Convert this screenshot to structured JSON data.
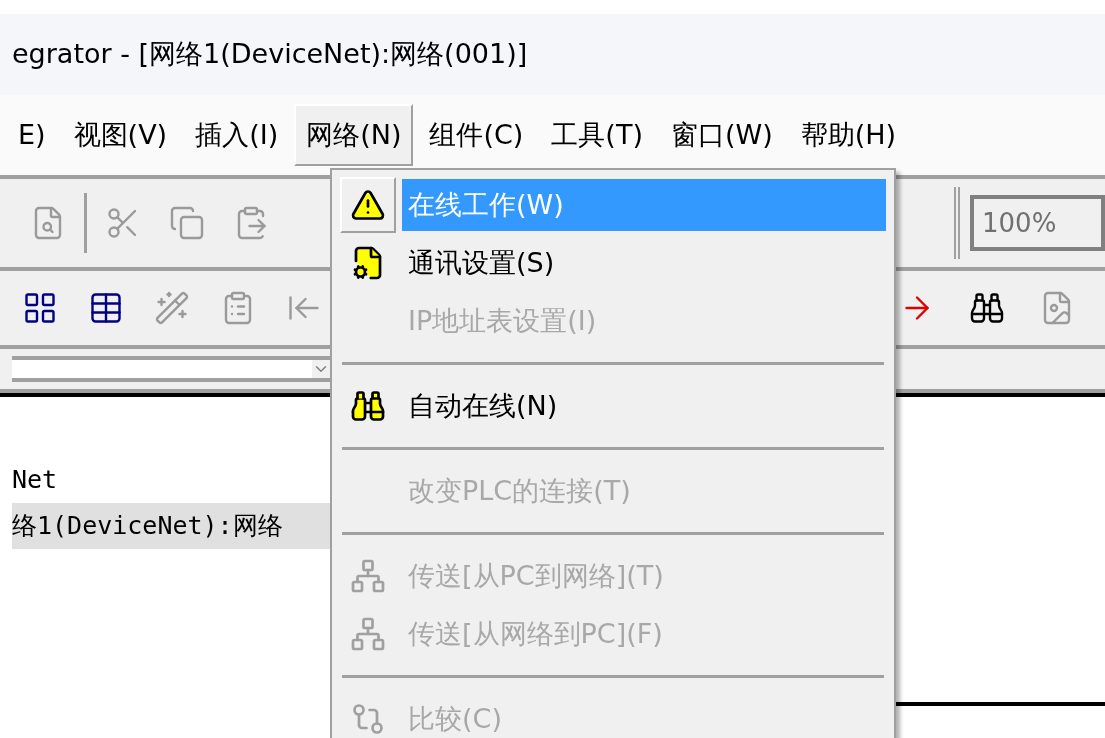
{
  "window": {
    "title": "egrator - [网络1(DeviceNet):网络(001)]"
  },
  "menu_bar": [
    {
      "label": "E)",
      "selected": false
    },
    {
      "label": "视图(V)",
      "selected": false
    },
    {
      "label": "插入(I)",
      "selected": false
    },
    {
      "label": "网络(N)",
      "selected": true
    },
    {
      "label": "组件(C)",
      "selected": false
    },
    {
      "label": "工具(T)",
      "selected": false
    },
    {
      "label": "窗口(W)",
      "selected": false
    },
    {
      "label": "帮助(H)",
      "selected": false
    }
  ],
  "zoom_field": {
    "value": "100%"
  },
  "tree": [
    {
      "label": "Net",
      "selected": false
    },
    {
      "label": "络1(DeviceNet):网络",
      "selected": true
    }
  ],
  "network_menu": [
    {
      "kind": "item",
      "label": "在线工作(W)",
      "selected": true,
      "disabled": false
    },
    {
      "kind": "item",
      "label": "通讯设置(S)",
      "selected": false,
      "disabled": false
    },
    {
      "kind": "item",
      "label": "IP地址表设置(I)",
      "selected": false,
      "disabled": true
    },
    {
      "kind": "separator"
    },
    {
      "kind": "item",
      "label": "自动在线(N)",
      "selected": false,
      "disabled": false
    },
    {
      "kind": "separator"
    },
    {
      "kind": "item",
      "label": "改变PLC的连接(T)",
      "selected": false,
      "disabled": true
    },
    {
      "kind": "separator"
    },
    {
      "kind": "item",
      "label": "传送[从PC到网络](T)",
      "selected": false,
      "disabled": true
    },
    {
      "kind": "item",
      "label": "传送[从网络到PC](F)",
      "selected": false,
      "disabled": true
    },
    {
      "kind": "separator"
    },
    {
      "kind": "item",
      "label": "比较(C)",
      "selected": false,
      "disabled": true
    }
  ]
}
